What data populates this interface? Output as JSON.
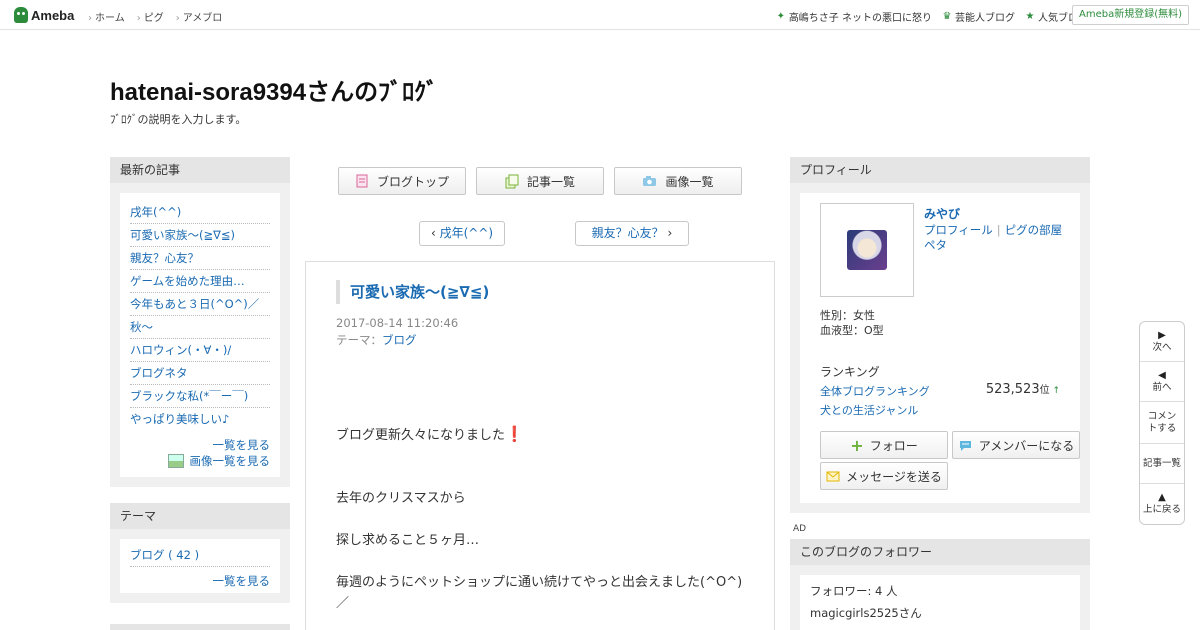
{
  "topbar": {
    "logo": "Ameba",
    "nav": [
      "ホーム",
      "ピグ",
      "アメブロ"
    ],
    "right": [
      {
        "icon": "sparkle-icon",
        "label": "高嶋ちさ子 ネットの悪口に怒り"
      },
      {
        "icon": "crown-icon",
        "label": "芸能人ブログ"
      },
      {
        "icon": "star-icon",
        "label": "人気ブログ"
      }
    ],
    "signup": "Ameba新規登録(無料)"
  },
  "header": {
    "title": "hatenai-sora9394さんのﾌﾞﾛｸﾞ",
    "description": "ﾌﾞﾛｸﾞの説明を入力します。"
  },
  "recent": {
    "heading": "最新の記事",
    "items": [
      "戌年(^^)",
      "可愛い家族～(≧∇≦)",
      "親友？心友？",
      "ゲームを始めた理由…",
      "今年もあと３日(^O^)／",
      "秋～",
      "ハロウィン(・∀・)/",
      "ブログネタ",
      "ブラックな私(*￣ー￣)",
      "やっぱり美味しい♪"
    ],
    "more": "一覧を見る",
    "images": "画像一覧を見る"
  },
  "theme": {
    "heading": "テーマ",
    "item": "ブログ ( 42 )",
    "more": "一覧を見る"
  },
  "tabs": {
    "top": "ブログトップ",
    "list": "記事一覧",
    "images": "画像一覧"
  },
  "pager": {
    "prev": "戌年(^^)",
    "next": "親友？心友？"
  },
  "article": {
    "title": "可愛い家族～(≧∇≦)",
    "date": "2017-08-14 11:20:46",
    "theme_label": "テーマ：",
    "theme": "ブログ",
    "body": [
      "ブログ更新久々になりました",
      "去年のクリスマスから",
      "探し求めること５ヶ月…",
      "毎週のようにペットショップに通い続けてやっと出会えました(^O^)／"
    ]
  },
  "profile": {
    "heading": "プロフィール",
    "name": "みやび",
    "link_profile": "プロフィール",
    "link_room": "ピグの部屋",
    "link_pet": "ペタ",
    "gender": "性別：女性",
    "blood": "血液型：O型",
    "ranking_label": "ランキング",
    "ranking_all": "全体ブログランキング",
    "ranking_genre": "犬との生活ジャンル",
    "rank_value": "523,523",
    "rank_unit": "位",
    "follow": "フォロー",
    "amember": "アメンバーになる",
    "message": "メッセージを送る"
  },
  "ad": "AD",
  "followers": {
    "heading": "このブログのフォロワー",
    "count": "フォロワー: 4 人",
    "first": "magicgirls2525さん"
  },
  "sidenav": {
    "next": "次へ",
    "prev": "前へ",
    "comment": "コメントする",
    "list": "記事一覧",
    "top": "上に戻る"
  },
  "colors": {
    "accent": "#2d8c3c",
    "link": "#1a6ab2",
    "panel": "#e5e5e5"
  }
}
